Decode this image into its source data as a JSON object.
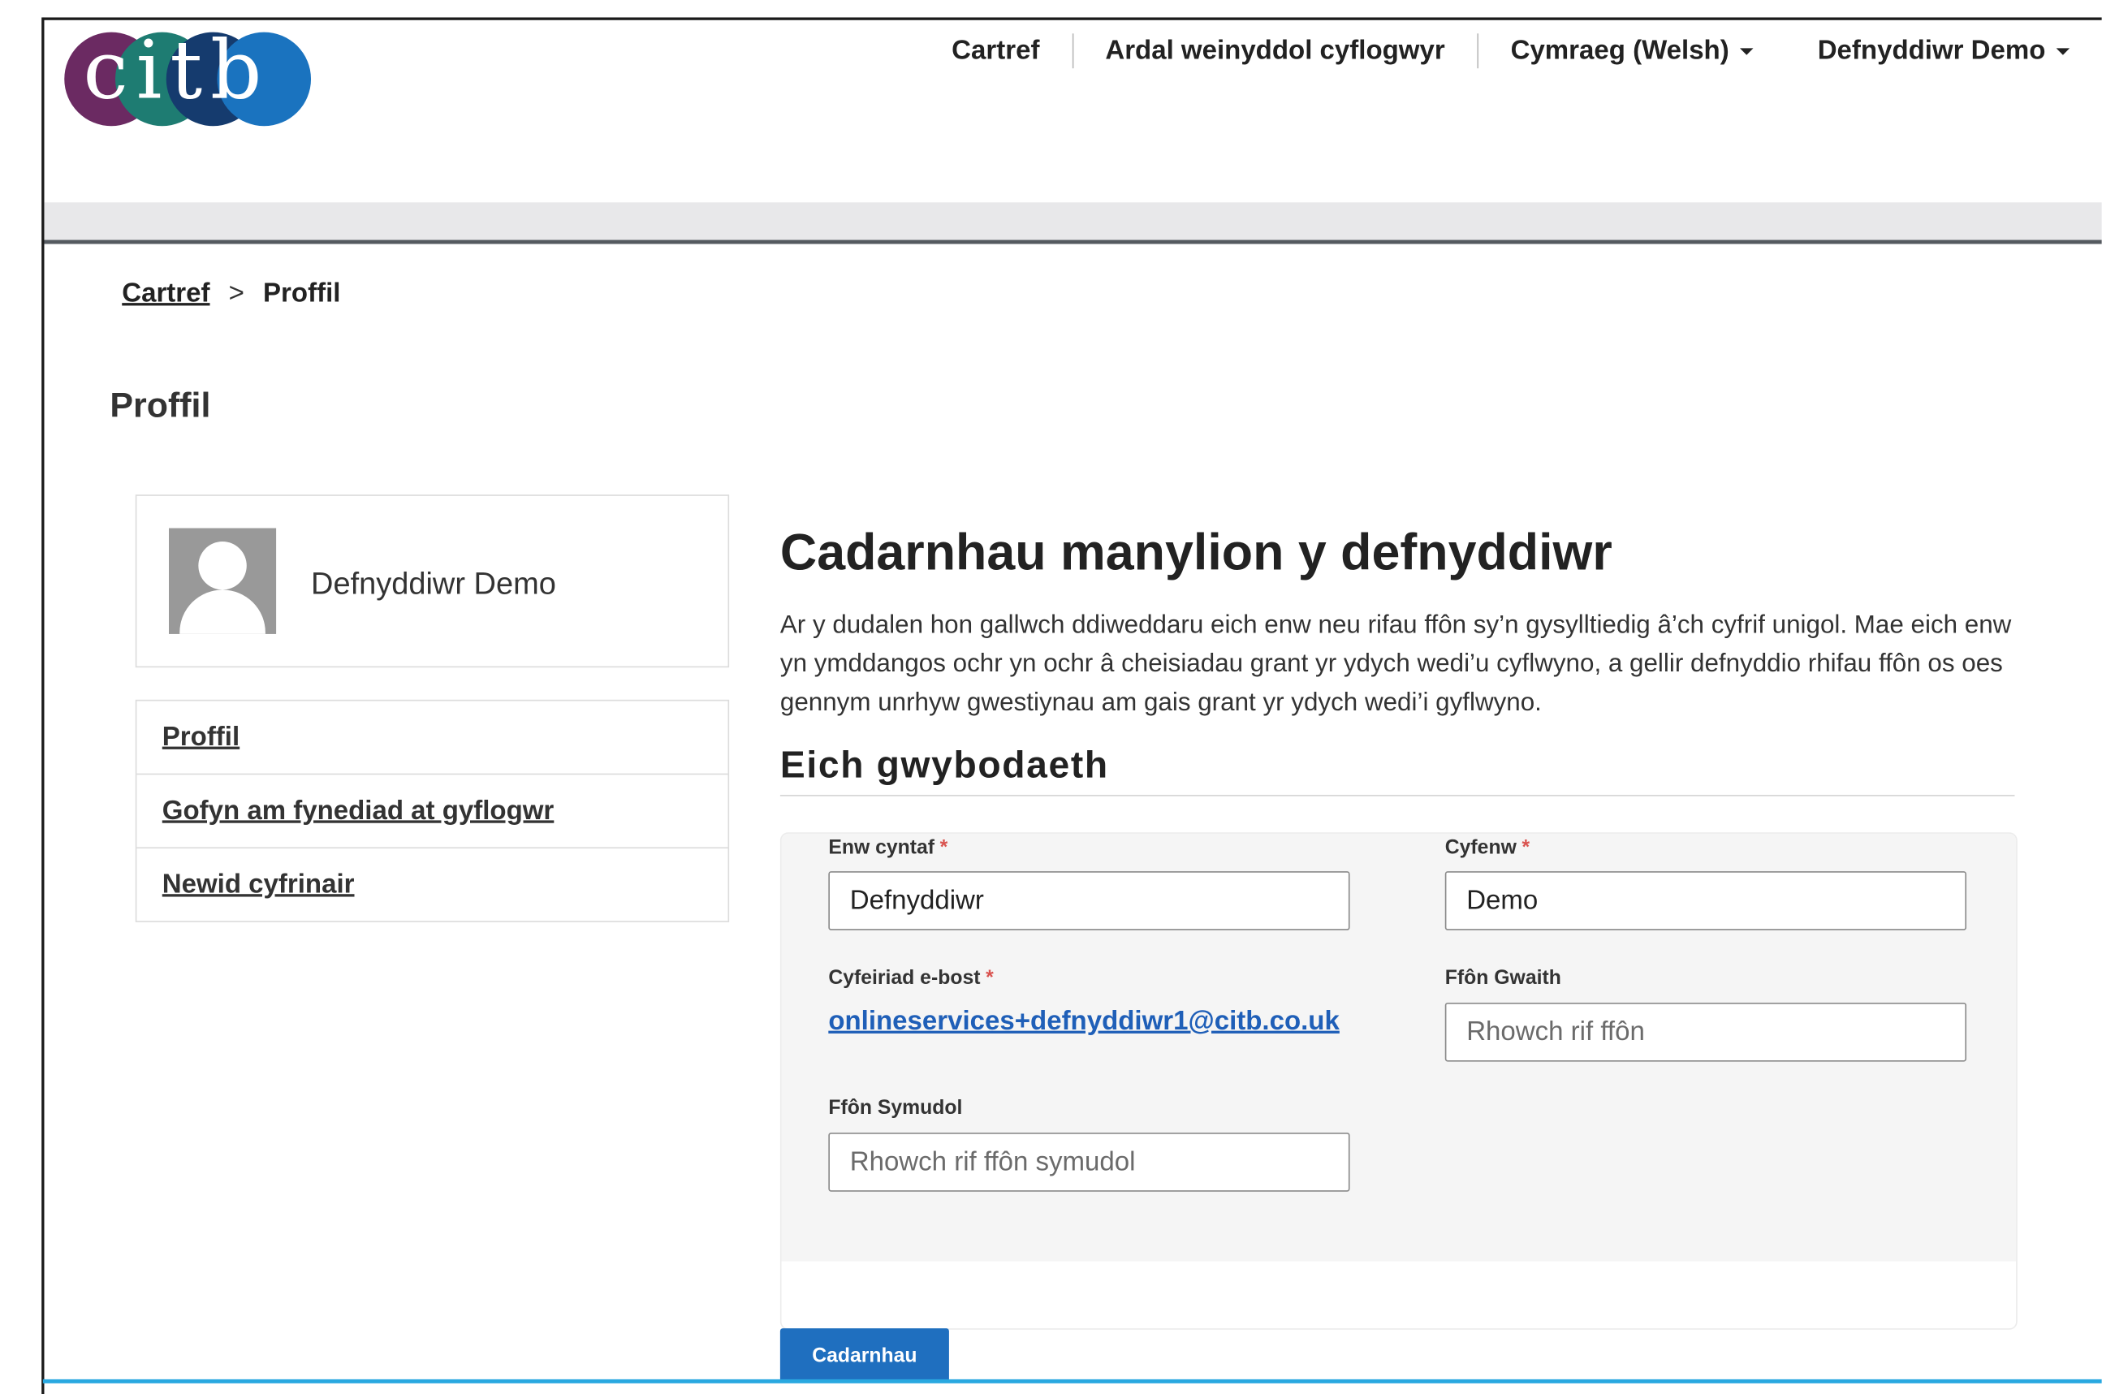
{
  "brand": {
    "logo_text": "citb",
    "logo_colors": [
      "#6b2a62",
      "#1e7c72",
      "#153b6e",
      "#1a73bf"
    ]
  },
  "topnav": {
    "home": "Cartref",
    "employer_admin": "Ardal weinyddol cyflogwyr",
    "language": "Cymraeg (Welsh)",
    "user": "Defnyddiwr Demo"
  },
  "breadcrumb": {
    "home": "Cartref",
    "separator": ">",
    "current": "Proffil"
  },
  "page": {
    "title": "Proffil"
  },
  "profile_card": {
    "name": "Defnyddiwr Demo"
  },
  "side_menu": {
    "items": [
      {
        "label": "Proffil"
      },
      {
        "label": "Gofyn am fynediad at gyflogwr"
      },
      {
        "label": "Newid cyfrinair"
      }
    ]
  },
  "main": {
    "heading": "Cadarnhau manylion y defnyddiwr",
    "intro": "Ar y dudalen hon gallwch ddiweddaru eich enw neu rifau ffôn sy’n gysylltiedig â’ch cyfrif unigol. Mae eich enw yn ymddangos ochr yn ochr â cheisiadau grant yr ydych wedi’u cyflwyno, a gellir defnyddio rhifau ffôn os oes gennym unrhyw gwestiynau am gais grant yr ydych wedi’i gyflwyno.",
    "section_heading": "Eich gwybodaeth"
  },
  "form": {
    "required_marker": "*",
    "first_name": {
      "label": "Enw cyntaf",
      "value": "Defnyddiwr"
    },
    "surname": {
      "label": "Cyfenw",
      "value": "Demo"
    },
    "email": {
      "label": "Cyfeiriad e-bost",
      "value": "onlineservices+defnyddiwr1@citb.co.uk"
    },
    "work_phone": {
      "label": "Ffôn Gwaith",
      "value": "",
      "placeholder": "Rhowch rif ffôn"
    },
    "mobile_phone": {
      "label": "Ffôn Symudol",
      "value": "",
      "placeholder": "Rhowch rif ffôn symudol"
    },
    "submit_label": "Cadarnhau"
  },
  "colors": {
    "primary_button": "#1f6fbf",
    "link": "#1f5fb8",
    "required": "#d9534f",
    "bottom_rule": "#29a8e0"
  }
}
